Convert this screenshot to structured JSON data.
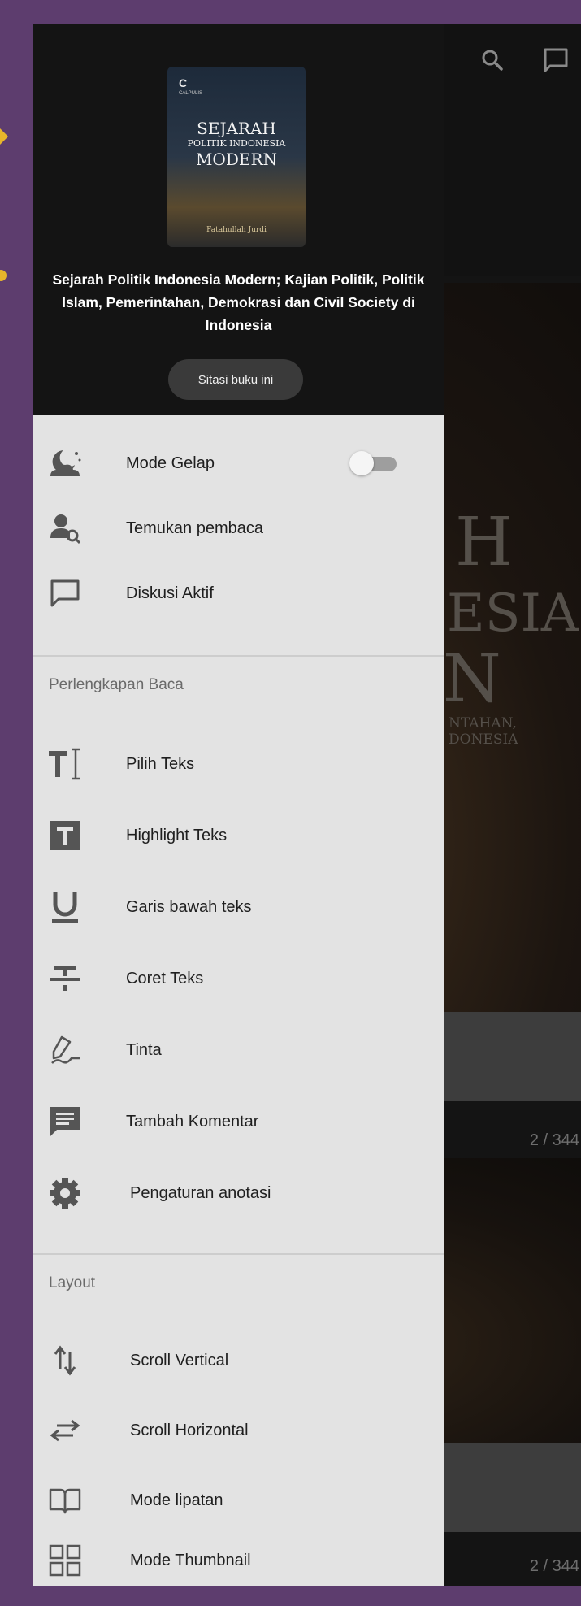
{
  "toolbar": {
    "search_icon": "search-icon",
    "chat_icon": "chat-icon"
  },
  "background_page": {
    "title_fragments": [
      "H",
      "ESIA",
      "N",
      "NTAHAN,",
      "DONESIA"
    ],
    "page_counter_1": "2 / 344",
    "page_counter_2": "2 / 344"
  },
  "book": {
    "cover": {
      "publisher": "CALPULIS",
      "line1": "SEJARAH",
      "line2": "POLITIK INDONESIA",
      "line3": "MODERN",
      "author": "Fatahullah Jurdi"
    },
    "title": "Sejarah Politik Indonesia Modern; Kajian Politik, Politik Islam, Pemerintahan, Demokrasi dan Civil Society di Indonesia",
    "cite_label": "Sitasi buku ini"
  },
  "menu_top": [
    {
      "label": "Mode Gelap",
      "icon": "night-mode-icon",
      "toggle_on": false
    },
    {
      "label": "Temukan pembaca",
      "icon": "find-reader-icon"
    },
    {
      "label": "Diskusi Aktif",
      "icon": "chat-icon"
    }
  ],
  "reading_tools": {
    "header": "Perlengkapan Baca",
    "items": [
      {
        "label": "Pilih Teks",
        "icon": "select-text-icon"
      },
      {
        "label": "Highlight Teks",
        "icon": "highlight-text-icon"
      },
      {
        "label": "Garis bawah teks",
        "icon": "underline-icon"
      },
      {
        "label": "Coret Teks",
        "icon": "strikethrough-icon"
      },
      {
        "label": "Tinta",
        "icon": "ink-icon"
      },
      {
        "label": "Tambah Komentar",
        "icon": "add-comment-icon"
      },
      {
        "label": "Pengaturan anotasi",
        "icon": "settings-gear-icon"
      }
    ]
  },
  "layout": {
    "header": "Layout",
    "items": [
      {
        "label": "Scroll Vertical",
        "icon": "scroll-vertical-icon"
      },
      {
        "label": "Scroll Horizontal",
        "icon": "scroll-horizontal-icon"
      },
      {
        "label": "Mode lipatan",
        "icon": "book-open-icon"
      },
      {
        "label": "Mode Thumbnail",
        "icon": "thumbnail-grid-icon"
      }
    ]
  },
  "colors": {
    "frame": "#5d3d6e",
    "accent": "#e7b52b",
    "drawer": "#e3e3e3",
    "header": "#141414"
  }
}
